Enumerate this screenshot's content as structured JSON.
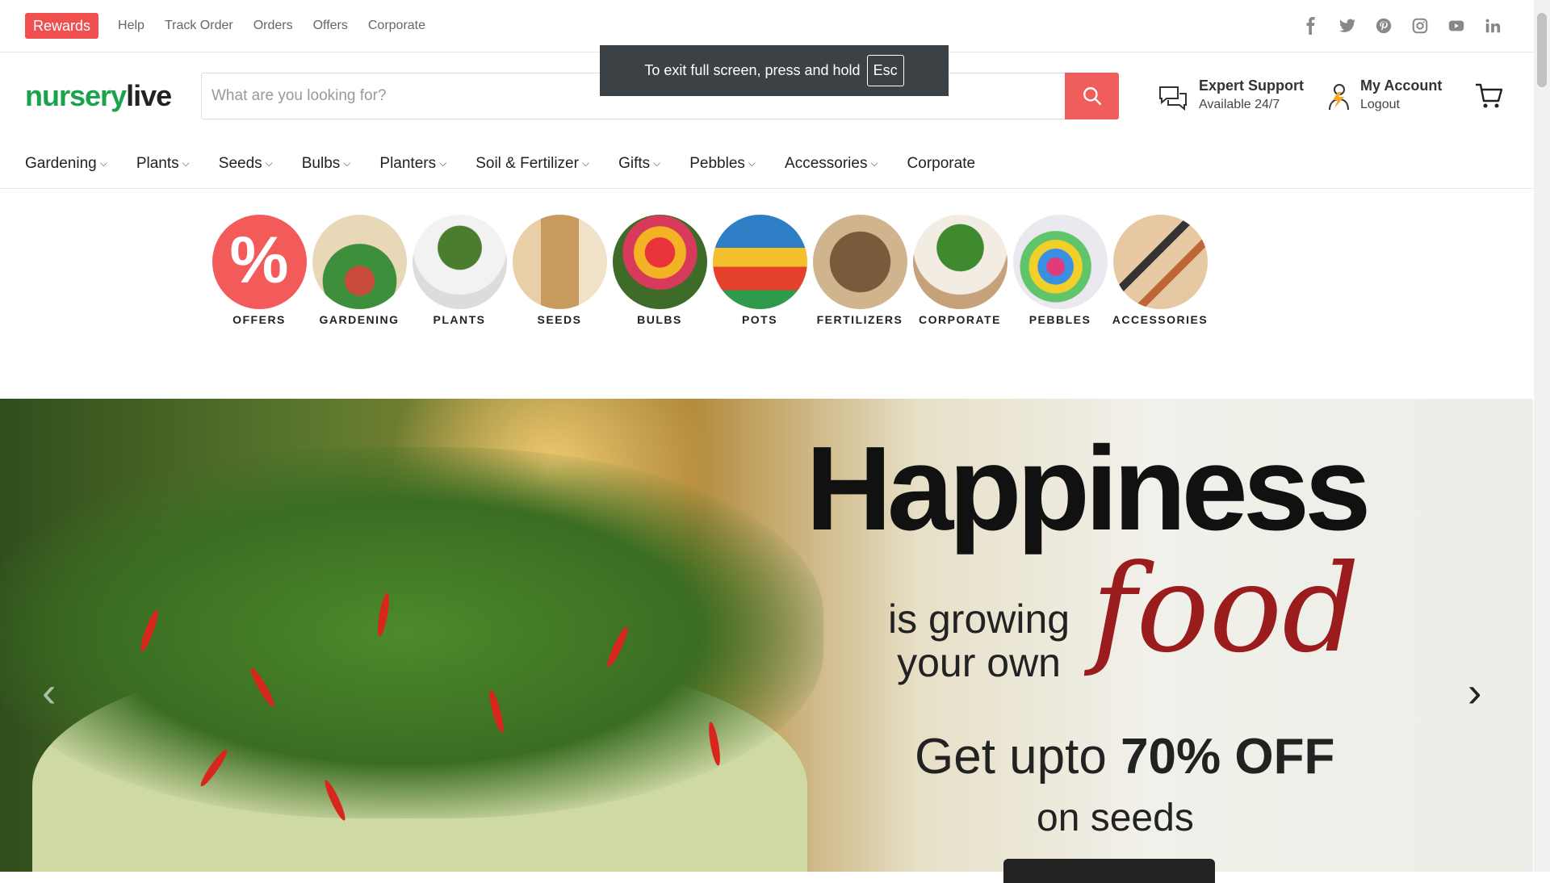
{
  "topbar": {
    "rewards": "Rewards",
    "links": [
      "Help",
      "Track Order",
      "Orders",
      "Offers",
      "Corporate"
    ],
    "social": [
      "facebook-icon",
      "twitter-icon",
      "pinterest-icon",
      "instagram-icon",
      "youtube-icon",
      "linkedin-icon"
    ]
  },
  "header": {
    "logo_green": "nursery",
    "logo_black": "live",
    "search_placeholder": "What are you looking for?",
    "support_title": "Expert Support",
    "support_sub": "Available 24/7",
    "account_title": "My Account",
    "account_sub": "Logout"
  },
  "nav": [
    "Gardening",
    "Plants",
    "Seeds",
    "Bulbs",
    "Planters",
    "Soil & Fertilizer",
    "Gifts",
    "Pebbles",
    "Accessories",
    "Corporate"
  ],
  "fullscreen": {
    "message": "To exit full screen, press and hold",
    "key": "Esc"
  },
  "categories": [
    "OFFERS",
    "GARDENING",
    "PLANTS",
    "SEEDS",
    "BULBS",
    "POTS",
    "FERTILIZERS",
    "CORPORATE",
    "PEBBLES",
    "ACCESSORIES"
  ],
  "category_icon": "%",
  "hero": {
    "title": "Happiness",
    "sub_line1": "is growing",
    "sub_line2": "your own",
    "food": "food",
    "offer_prefix": "Get upto ",
    "offer_bold": "70% OFF",
    "seeds": "on seeds",
    "prev": "‹",
    "next": "›"
  },
  "colors": {
    "brand_green": "#19a34a",
    "accent_red": "#ef5d5d"
  }
}
